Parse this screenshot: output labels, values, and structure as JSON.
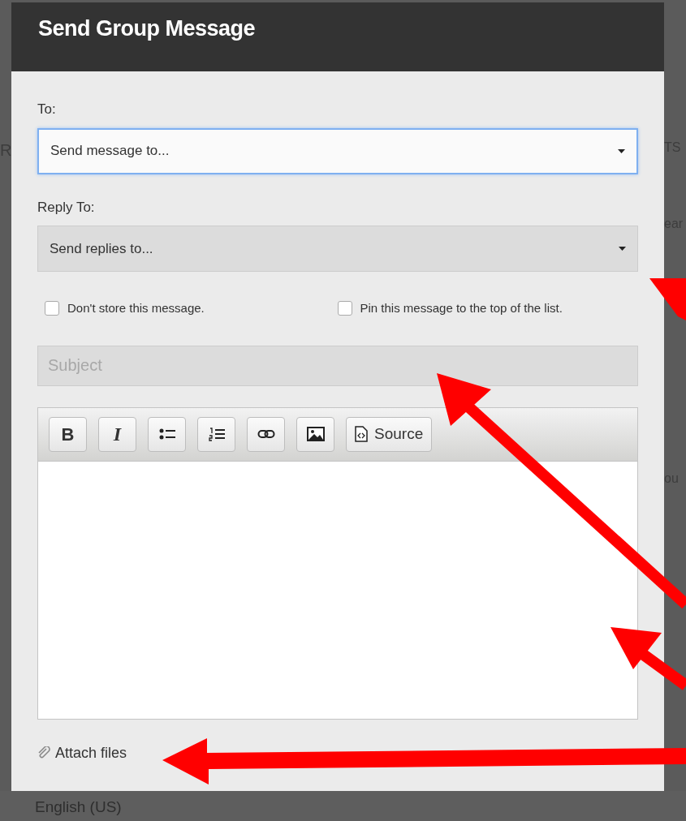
{
  "dialog": {
    "title": "Send Group Message"
  },
  "to": {
    "label": "To:",
    "placeholder": "Send message to...",
    "focused": true
  },
  "reply_to": {
    "label": "Reply To:",
    "placeholder": "Send replies to...",
    "focused": false
  },
  "options": [
    {
      "label": "Don't store this message.",
      "checked": false
    },
    {
      "label": "Pin this message to the top of the list.",
      "checked": false
    }
  ],
  "subject": {
    "placeholder": "Subject"
  },
  "toolbar": [
    {
      "kind": "bold",
      "label": "B"
    },
    {
      "kind": "italic",
      "label": "I"
    },
    {
      "kind": "bullets"
    },
    {
      "kind": "numbers"
    },
    {
      "kind": "link"
    },
    {
      "kind": "image"
    },
    {
      "kind": "source",
      "label": "Source"
    }
  ],
  "attach": {
    "label": "Attach files"
  },
  "background": {
    "left_fragments": [
      "R"
    ],
    "right_fragments": [
      "TS",
      "ear",
      "ou"
    ],
    "footer": "English (US)"
  }
}
